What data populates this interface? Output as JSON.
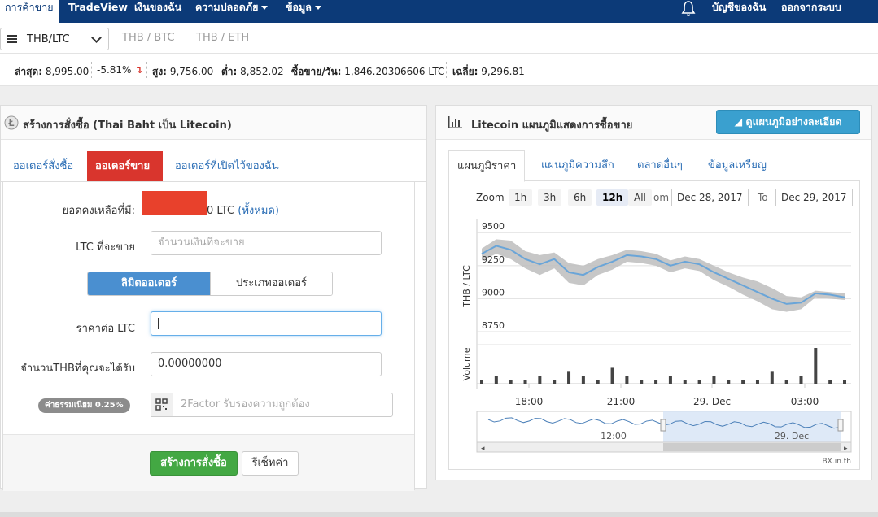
{
  "nav": {
    "items": [
      "การค้าขาย",
      "TradeView",
      "เงินของฉัน",
      "ความปลอดภัย",
      "ข้อมูล"
    ],
    "right_items": [
      "บัญชีของฉัน",
      "ออกจากระบบ"
    ]
  },
  "pairbar": {
    "selected": "THB/LTC",
    "links": [
      "THB / BTC",
      "THB / ETH"
    ]
  },
  "ticker": {
    "last_label": "ล่าสุด:",
    "last_value": "8,995.00",
    "change": "-5.81%",
    "high_label": "สูง:",
    "high_value": "9,756.00",
    "low_label": "ต่ำ:",
    "low_value": "8,852.02",
    "volume_label": "ซื้อขาย/วัน:",
    "volume_value": "1,846.20306606 LTC",
    "avg_label": "เฉลี่ย:",
    "avg_value": "9,296.81"
  },
  "order": {
    "title": "สร้างการสั่งซื้อ (Thai Baht เป็น Litecoin)",
    "tabs": [
      "ออเดอร์สั่งซื้อ",
      "ออเดอร์ขาย",
      "ออเดอร์ที่เปิดไว้ของฉัน"
    ],
    "balance_label": "ยอดคงเหลือที่มี:",
    "balance_suffix": "0 LTC",
    "balance_all": "(ทั้งหมด)",
    "amount_label": "LTC ที่จะขาย",
    "amount_placeholder": "จำนวนเงินที่จะขาย",
    "order_type_on": "ลิมิตออเดอร์",
    "order_type_off": "ประเภทออเดอร์",
    "price_label": "ราคาต่อ LTC",
    "receive_label": "จำนวนTHBที่คุณจะได้รับ",
    "receive_value": "0.00000000",
    "fee_badge": "ค่าธรรมเนียม 0.25%",
    "twofa_placeholder": "2Factor รับรองความถูกต้อง",
    "submit": "สร้างการสั่งซื้อ",
    "reset": "รีเซ็ทค่า"
  },
  "chart_panel": {
    "title": "Litecoin แผนภูมิแสดงการซื้อขาย",
    "detail_button": "ดูแผนภูมิอย่างละเอียด",
    "tabs": [
      "แผนภูมิราคา",
      "แผนภูมิความลึก",
      "ตลาดอื่นๆ",
      "ข้อมูลเหรียญ"
    ],
    "zoom_label": "Zoom",
    "zoom_options": [
      "1h",
      "3h",
      "6h",
      "12h",
      "All"
    ],
    "zoom_selected": "12h",
    "from_label_fragment": "om",
    "from_date": "Dec 28, 2017",
    "to_label": "To",
    "to_date": "Dec 29, 2017",
    "credit": "BX.in.th",
    "colors": {
      "line": "#6aa5d8",
      "band": "#bdbdbd",
      "volume": "#444444",
      "navigator_fill": "#d6e4f5"
    }
  },
  "chart_data": {
    "type": "line",
    "ylabel": "THB / LTC",
    "volume_label": "Volume",
    "y_ticks": [
      9500,
      9250,
      9000,
      8750
    ],
    "ylim": [
      8750,
      9600
    ],
    "x_ticks": [
      "18:00",
      "21:00",
      "29. Dec",
      "03:00"
    ],
    "navigator_ticks": [
      "12:00",
      "29. Dec"
    ],
    "x": [
      "15:30",
      "16:00",
      "16:30",
      "17:00",
      "17:30",
      "18:00",
      "18:30",
      "19:00",
      "19:30",
      "20:00",
      "20:30",
      "21:00",
      "21:30",
      "22:00",
      "22:30",
      "23:00",
      "23:30",
      "00:00",
      "00:30",
      "01:00",
      "01:30",
      "02:00",
      "02:30",
      "03:00",
      "03:30",
      "04:00"
    ],
    "series": [
      {
        "values": [
          9340,
          9400,
          9370,
          9300,
          9260,
          9300,
          9200,
          9180,
          9240,
          9280,
          9330,
          9320,
          9300,
          9250,
          9280,
          9260,
          9200,
          9150,
          9100,
          9050,
          9000,
          8960,
          8970,
          9040,
          9030,
          9010
        ]
      }
    ],
    "band_high": [
      9380,
      9450,
      9440,
      9360,
      9330,
      9350,
      9270,
      9250,
      9300,
      9330,
      9370,
      9360,
      9340,
      9290,
      9320,
      9300,
      9250,
      9200,
      9160,
      9130,
      9080,
      9020,
      9010,
      9060,
      9050,
      9040
    ],
    "band_low": [
      9290,
      9340,
      9300,
      9230,
      9180,
      9230,
      9120,
      9100,
      9180,
      9220,
      9280,
      9270,
      9250,
      9200,
      9230,
      9210,
      9140,
      9090,
      9030,
      8980,
      8920,
      8900,
      8920,
      9010,
      9000,
      8990
    ],
    "volume": [
      1,
      2,
      1,
      1,
      2,
      1,
      3,
      2,
      1,
      4,
      2,
      1,
      1,
      2,
      1,
      1,
      2,
      1,
      1,
      1,
      3,
      1,
      2,
      9,
      1,
      1
    ]
  }
}
